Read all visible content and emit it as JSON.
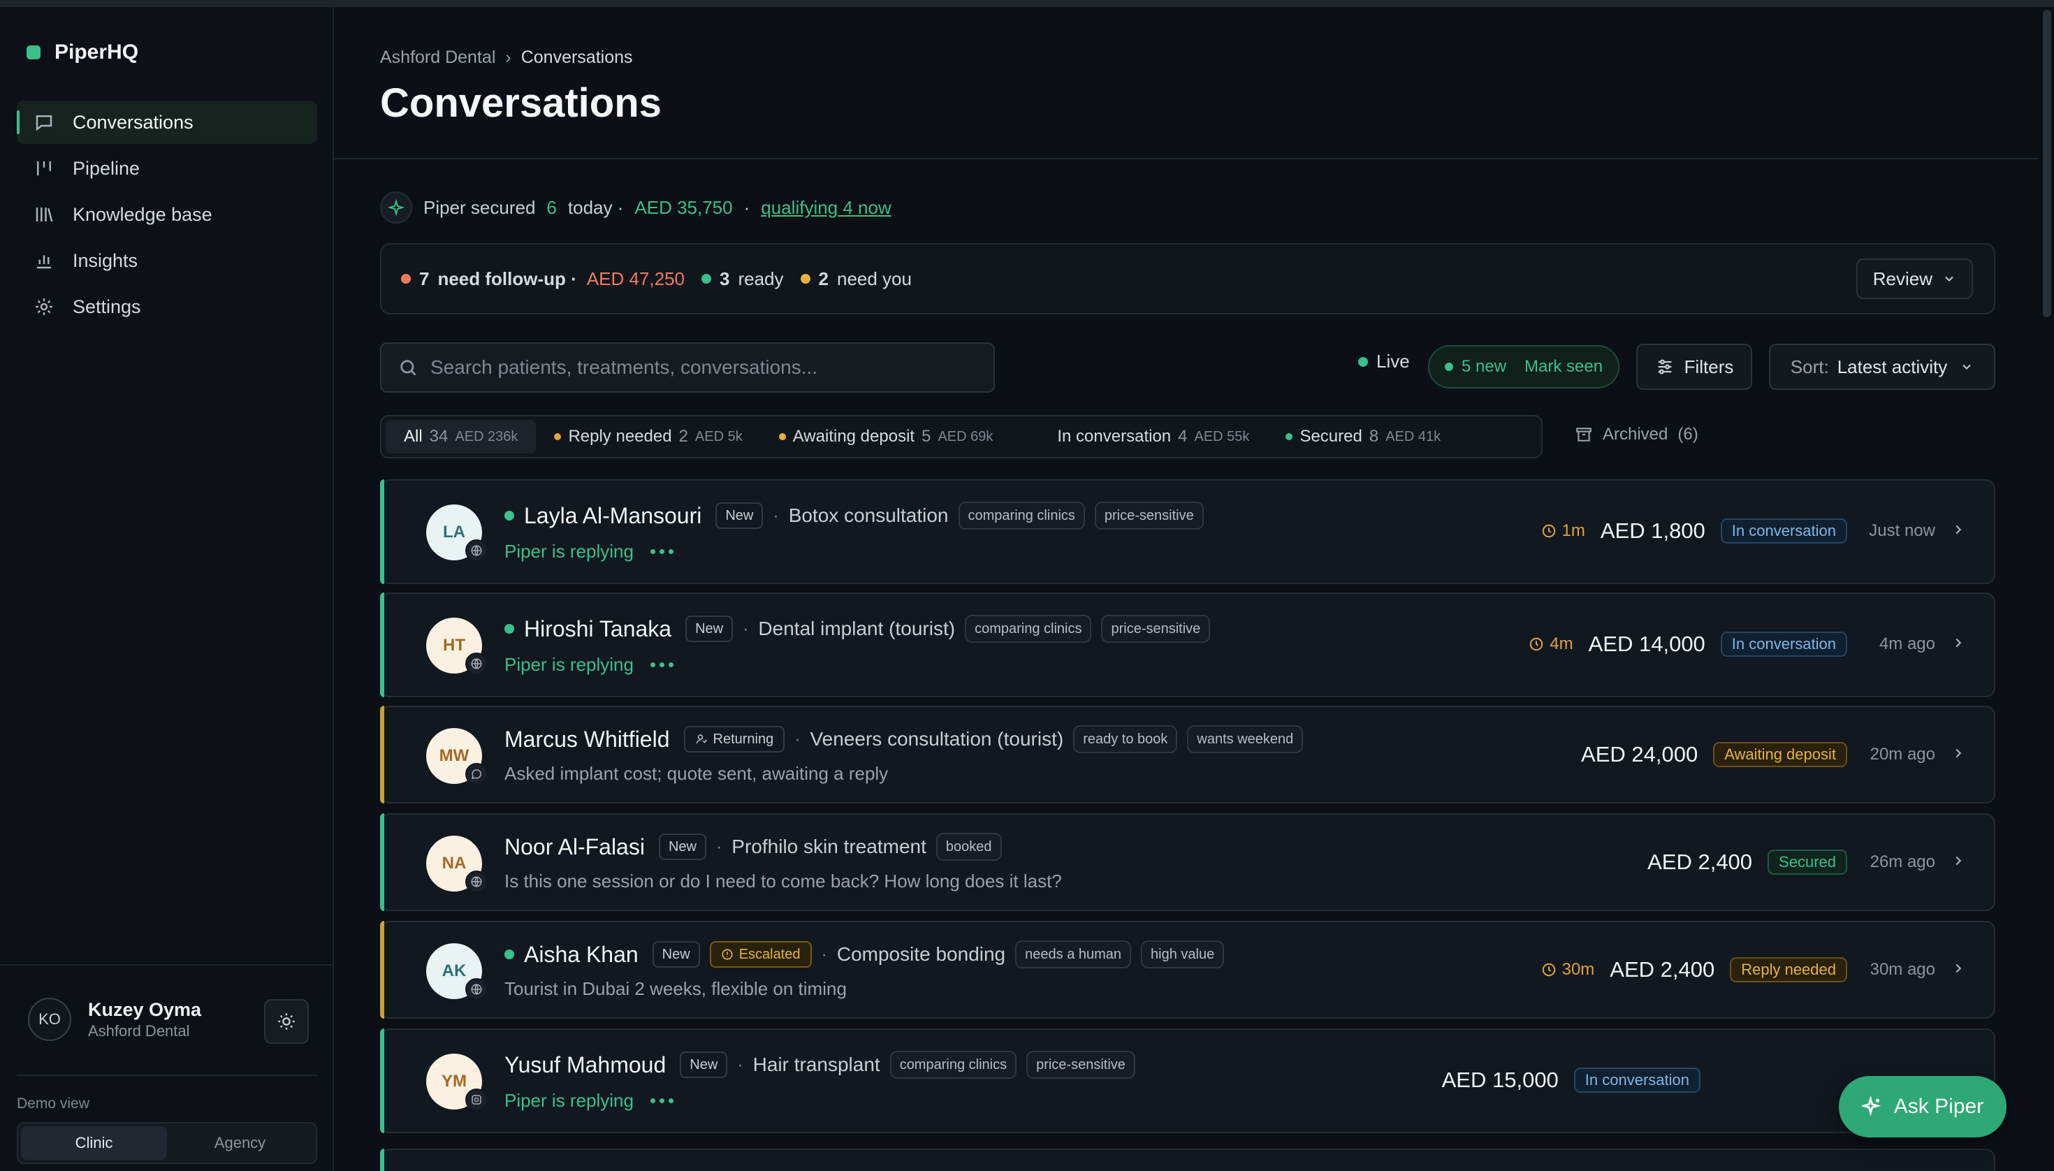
{
  "app": {
    "name": "PiperHQ"
  },
  "colors": {
    "accent": "#3bbf8c",
    "warning": "#e3b341",
    "danger": "#f07a5f",
    "info": "#7fb6e6"
  },
  "sidebar": {
    "items": [
      {
        "label": "Conversations",
        "icon": "chat-bubble-icon",
        "active": true
      },
      {
        "label": "Pipeline",
        "icon": "pipeline-icon"
      },
      {
        "label": "Knowledge base",
        "icon": "library-icon"
      },
      {
        "label": "Insights",
        "icon": "bar-chart-icon"
      },
      {
        "label": "Settings",
        "icon": "gear-icon"
      }
    ],
    "user": {
      "initials": "KO",
      "name": "Kuzey Oyma",
      "org": "Ashford Dental"
    },
    "demo_label": "Demo view",
    "demo_options": [
      "Clinic",
      "Agency"
    ],
    "demo_selected": "Clinic"
  },
  "header": {
    "breadcrumb": [
      "Ashford Dental",
      "Conversations"
    ],
    "title": "Conversations"
  },
  "summary": {
    "prefix": "Piper secured",
    "count": "6",
    "mid": "today ·",
    "amount": "AED 35,750",
    "sep": "·",
    "link": "qualifying 4 now"
  },
  "alert": {
    "followup_count": "7",
    "followup_label": "need follow-up ·",
    "followup_amount": "AED 47,250",
    "ready_count": "3",
    "ready_label": "ready",
    "needyou_count": "2",
    "needyou_label": "need you",
    "review_label": "Review"
  },
  "toolbar": {
    "search_placeholder": "Search patients, treatments, conversations...",
    "live_label": "Live",
    "new_label": "5 new",
    "mark_seen": "Mark seen",
    "filters_label": "Filters",
    "sort_prefix": "Sort:",
    "sort_value": "Latest activity"
  },
  "tabs": [
    {
      "label": "All",
      "count": "34",
      "amount": "AED 236k",
      "active": true
    },
    {
      "label": "Reply needed",
      "count": "2",
      "amount": "AED 5k",
      "dot": "#e3a33b"
    },
    {
      "label": "Awaiting deposit",
      "count": "5",
      "amount": "AED 69k",
      "dot": "#e3b341"
    },
    {
      "label": "In conversation",
      "count": "4",
      "amount": "AED 55k"
    },
    {
      "label": "Secured",
      "count": "8",
      "amount": "AED 41k",
      "dot": "#3bbf8c"
    }
  ],
  "archived": {
    "label": "Archived",
    "count": "(6)"
  },
  "rows": [
    {
      "initials": "LA",
      "channel": "globe-icon",
      "online": true,
      "name": "Layla Al-Mansouri",
      "badge": "New",
      "treatment": "Botox consultation",
      "tags": [
        "comparing clinics",
        "price-sensitive"
      ],
      "line2": "Piper is replying",
      "replying": true,
      "timer": "1m",
      "amount": "AED 1,800",
      "status": "In conversation",
      "status_kind": "conv",
      "ago": "Just now",
      "accent": "#3bbf8c",
      "av_bg": "#e9f3f4",
      "av_fg": "#2f6f78"
    },
    {
      "initials": "HT",
      "channel": "globe-icon",
      "online": true,
      "name": "Hiroshi Tanaka",
      "badge": "New",
      "treatment": "Dental implant (tourist)",
      "tags": [
        "comparing clinics",
        "price-sensitive"
      ],
      "line2": "Piper is replying",
      "replying": true,
      "timer": "4m",
      "amount": "AED 14,000",
      "status": "In conversation",
      "status_kind": "conv",
      "ago": "4m ago",
      "accent": "#3bbf8c",
      "av_bg": "#faf1e2",
      "av_fg": "#a26a25"
    },
    {
      "initials": "MW",
      "channel": "whatsapp-icon",
      "online": false,
      "name": "Marcus Whitfield",
      "badge": "Returning",
      "badge_kind": "ret",
      "treatment": "Veneers consultation (tourist)",
      "tags": [
        "ready to book",
        "wants weekend"
      ],
      "line2": "Asked implant cost; quote sent, awaiting a reply",
      "replying": false,
      "timer": "",
      "amount": "AED 24,000",
      "status": "Awaiting deposit",
      "status_kind": "dep",
      "ago": "20m ago",
      "accent": "#c9a13a",
      "av_bg": "#faf1e2",
      "av_fg": "#a26a25"
    },
    {
      "initials": "NA",
      "channel": "globe-icon",
      "online": false,
      "name": "Noor Al-Falasi",
      "badge": "New",
      "treatment": "Profhilo skin treatment",
      "tags": [
        "booked"
      ],
      "line2": "Is this one session or do I need to come back? How long does it last?",
      "replying": false,
      "timer": "",
      "amount": "AED 2,400",
      "status": "Secured",
      "status_kind": "sec",
      "ago": "26m ago",
      "accent": "#3bbf8c",
      "av_bg": "#faf1e2",
      "av_fg": "#a26a25"
    },
    {
      "initials": "AK",
      "channel": "globe-icon",
      "online": true,
      "name": "Aisha Khan",
      "badge": "New",
      "escalated": "Escalated",
      "treatment": "Composite bonding",
      "tags": [
        "needs a human",
        "high value"
      ],
      "line2": "Tourist in Dubai 2 weeks, flexible on timing",
      "replying": false,
      "timer": "30m",
      "amount": "AED 2,400",
      "status": "Reply needed",
      "status_kind": "reply",
      "ago": "30m ago",
      "accent": "#c9a13a",
      "av_bg": "#e9f3f4",
      "av_fg": "#2f6f78"
    },
    {
      "initials": "YM",
      "channel": "instagram-icon",
      "online": false,
      "name": "Yusuf Mahmoud",
      "badge": "New",
      "treatment": "Hair transplant",
      "tags": [
        "comparing clinics",
        "price-sensitive"
      ],
      "line2": "Piper is replying",
      "replying": true,
      "timer": "",
      "amount": "AED 15,000",
      "status": "In conversation",
      "status_kind": "conv",
      "ago": "",
      "accent": "#3bbf8c",
      "av_bg": "#faf1e2",
      "av_fg": "#a26a25"
    }
  ],
  "ask_piper": "Ask Piper"
}
